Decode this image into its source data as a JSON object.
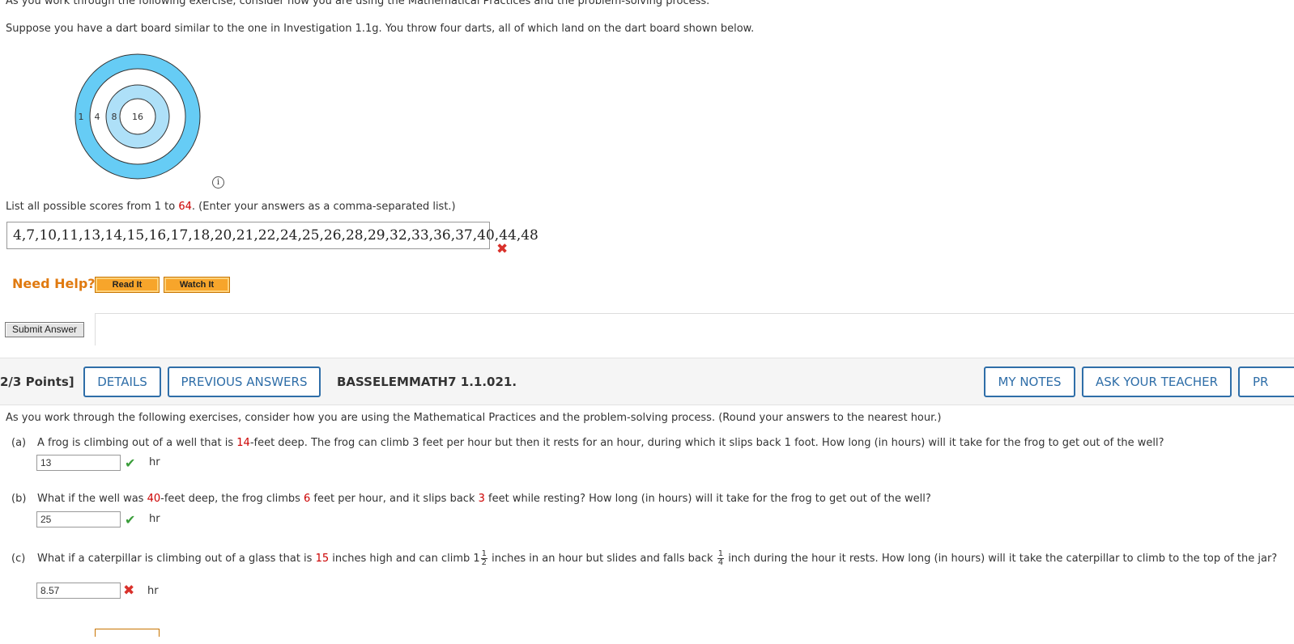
{
  "intro_top": "As you work through the following exercise, consider how you are using the Mathematical Practices and the problem-solving process.",
  "intro": "Suppose you have a dart board similar to the one in Investigation 1.1g. You throw four darts, all of which land on the dart board shown below.",
  "dartboard": {
    "ring_labels": [
      "1",
      "4",
      "8",
      "16"
    ],
    "colors": {
      "outer": "#66ccf5",
      "inner": "#aee0f8",
      "white": "#ffffff",
      "stroke": "#333333"
    }
  },
  "question_list": {
    "pre": "List all possible scores from 1 to ",
    "max": "64",
    "post": ". (Enter your answers as a comma-separated list.)",
    "answer": "4,7,10,11,13,14,15,16,17,18,20,21,22,24,25,26,28,29,32,33,36,37,40,44,48"
  },
  "help": {
    "label": "Need Help?",
    "read": "Read It",
    "watch": "Watch It"
  },
  "submit_label": "Submit Answer",
  "header": {
    "points": "2/3 Points]",
    "details": "DETAILS",
    "previous": "PREVIOUS ANSWERS",
    "code": "BASSELEMMATH7 1.1.021.",
    "my_notes": "MY NOTES",
    "ask_teacher": "ASK YOUR TEACHER",
    "practice": "PR"
  },
  "intro2": "As you work through the following exercises, consider how you are using the Mathematical Practices and the problem-solving process. (Round your answers to the nearest hour.)",
  "parts": {
    "a": {
      "label": "(a)",
      "t1": "A frog is climbing out of a well that is ",
      "v1": "14",
      "t2": "-feet deep. The frog can climb 3 feet per hour but then it rests for an hour, during which it slips back 1 foot. How long (in hours) will it take for the frog to get out of the well?",
      "answer": "13",
      "unit": "hr",
      "status": "correct"
    },
    "b": {
      "label": "(b)",
      "t1": "What if the well was ",
      "v1": "40",
      "t2": "-feet deep, the frog climbs ",
      "v2": "6",
      "t3": " feet per hour, and it slips back ",
      "v3": "3",
      "t4": " feet while resting? How long (in hours) will it take for the frog to get out of the well?",
      "answer": "25",
      "unit": "hr",
      "status": "correct"
    },
    "c": {
      "label": "(c)",
      "t1": "What if a caterpillar is climbing out of a glass that is ",
      "v1": "15",
      "t2": " inches high and can climb 1",
      "f1_num": "1",
      "f1_den": "2",
      "t3": " inches in an hour but slides and falls back ",
      "f2_num": "1",
      "f2_den": "4",
      "t4": " inch during the hour it rests. How long (in hours) will it take the caterpillar to climb to the top of the jar?",
      "answer": "8.57",
      "unit": "hr",
      "status": "incorrect"
    }
  },
  "marks": {
    "check": "✔",
    "cross": "✖",
    "info": "i"
  }
}
